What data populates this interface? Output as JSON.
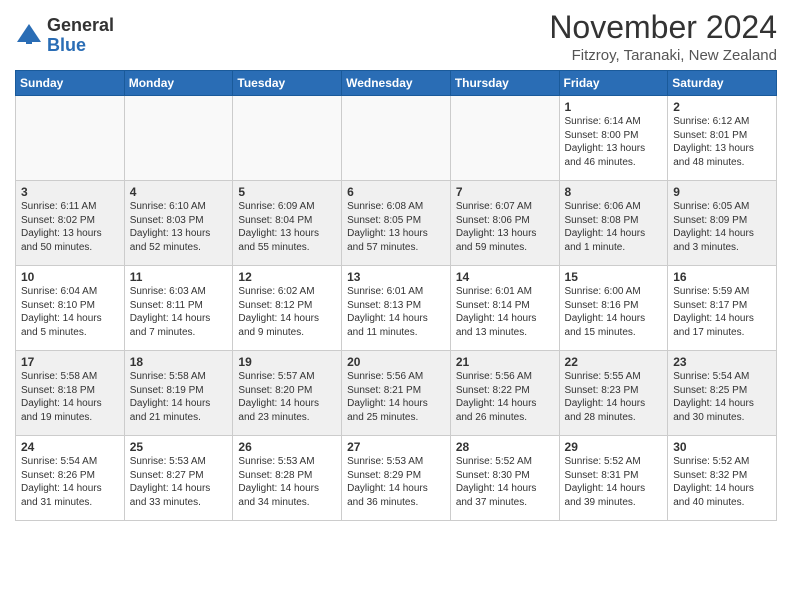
{
  "logo": {
    "general": "General",
    "blue": "Blue"
  },
  "header": {
    "month": "November 2024",
    "location": "Fitzroy, Taranaki, New Zealand"
  },
  "weekdays": [
    "Sunday",
    "Monday",
    "Tuesday",
    "Wednesday",
    "Thursday",
    "Friday",
    "Saturday"
  ],
  "weeks": [
    [
      {
        "day": "",
        "info": ""
      },
      {
        "day": "",
        "info": ""
      },
      {
        "day": "",
        "info": ""
      },
      {
        "day": "",
        "info": ""
      },
      {
        "day": "",
        "info": ""
      },
      {
        "day": "1",
        "info": "Sunrise: 6:14 AM\nSunset: 8:00 PM\nDaylight: 13 hours\nand 46 minutes."
      },
      {
        "day": "2",
        "info": "Sunrise: 6:12 AM\nSunset: 8:01 PM\nDaylight: 13 hours\nand 48 minutes."
      }
    ],
    [
      {
        "day": "3",
        "info": "Sunrise: 6:11 AM\nSunset: 8:02 PM\nDaylight: 13 hours\nand 50 minutes."
      },
      {
        "day": "4",
        "info": "Sunrise: 6:10 AM\nSunset: 8:03 PM\nDaylight: 13 hours\nand 52 minutes."
      },
      {
        "day": "5",
        "info": "Sunrise: 6:09 AM\nSunset: 8:04 PM\nDaylight: 13 hours\nand 55 minutes."
      },
      {
        "day": "6",
        "info": "Sunrise: 6:08 AM\nSunset: 8:05 PM\nDaylight: 13 hours\nand 57 minutes."
      },
      {
        "day": "7",
        "info": "Sunrise: 6:07 AM\nSunset: 8:06 PM\nDaylight: 13 hours\nand 59 minutes."
      },
      {
        "day": "8",
        "info": "Sunrise: 6:06 AM\nSunset: 8:08 PM\nDaylight: 14 hours\nand 1 minute."
      },
      {
        "day": "9",
        "info": "Sunrise: 6:05 AM\nSunset: 8:09 PM\nDaylight: 14 hours\nand 3 minutes."
      }
    ],
    [
      {
        "day": "10",
        "info": "Sunrise: 6:04 AM\nSunset: 8:10 PM\nDaylight: 14 hours\nand 5 minutes."
      },
      {
        "day": "11",
        "info": "Sunrise: 6:03 AM\nSunset: 8:11 PM\nDaylight: 14 hours\nand 7 minutes."
      },
      {
        "day": "12",
        "info": "Sunrise: 6:02 AM\nSunset: 8:12 PM\nDaylight: 14 hours\nand 9 minutes."
      },
      {
        "day": "13",
        "info": "Sunrise: 6:01 AM\nSunset: 8:13 PM\nDaylight: 14 hours\nand 11 minutes."
      },
      {
        "day": "14",
        "info": "Sunrise: 6:01 AM\nSunset: 8:14 PM\nDaylight: 14 hours\nand 13 minutes."
      },
      {
        "day": "15",
        "info": "Sunrise: 6:00 AM\nSunset: 8:16 PM\nDaylight: 14 hours\nand 15 minutes."
      },
      {
        "day": "16",
        "info": "Sunrise: 5:59 AM\nSunset: 8:17 PM\nDaylight: 14 hours\nand 17 minutes."
      }
    ],
    [
      {
        "day": "17",
        "info": "Sunrise: 5:58 AM\nSunset: 8:18 PM\nDaylight: 14 hours\nand 19 minutes."
      },
      {
        "day": "18",
        "info": "Sunrise: 5:58 AM\nSunset: 8:19 PM\nDaylight: 14 hours\nand 21 minutes."
      },
      {
        "day": "19",
        "info": "Sunrise: 5:57 AM\nSunset: 8:20 PM\nDaylight: 14 hours\nand 23 minutes."
      },
      {
        "day": "20",
        "info": "Sunrise: 5:56 AM\nSunset: 8:21 PM\nDaylight: 14 hours\nand 25 minutes."
      },
      {
        "day": "21",
        "info": "Sunrise: 5:56 AM\nSunset: 8:22 PM\nDaylight: 14 hours\nand 26 minutes."
      },
      {
        "day": "22",
        "info": "Sunrise: 5:55 AM\nSunset: 8:23 PM\nDaylight: 14 hours\nand 28 minutes."
      },
      {
        "day": "23",
        "info": "Sunrise: 5:54 AM\nSunset: 8:25 PM\nDaylight: 14 hours\nand 30 minutes."
      }
    ],
    [
      {
        "day": "24",
        "info": "Sunrise: 5:54 AM\nSunset: 8:26 PM\nDaylight: 14 hours\nand 31 minutes."
      },
      {
        "day": "25",
        "info": "Sunrise: 5:53 AM\nSunset: 8:27 PM\nDaylight: 14 hours\nand 33 minutes."
      },
      {
        "day": "26",
        "info": "Sunrise: 5:53 AM\nSunset: 8:28 PM\nDaylight: 14 hours\nand 34 minutes."
      },
      {
        "day": "27",
        "info": "Sunrise: 5:53 AM\nSunset: 8:29 PM\nDaylight: 14 hours\nand 36 minutes."
      },
      {
        "day": "28",
        "info": "Sunrise: 5:52 AM\nSunset: 8:30 PM\nDaylight: 14 hours\nand 37 minutes."
      },
      {
        "day": "29",
        "info": "Sunrise: 5:52 AM\nSunset: 8:31 PM\nDaylight: 14 hours\nand 39 minutes."
      },
      {
        "day": "30",
        "info": "Sunrise: 5:52 AM\nSunset: 8:32 PM\nDaylight: 14 hours\nand 40 minutes."
      }
    ]
  ]
}
